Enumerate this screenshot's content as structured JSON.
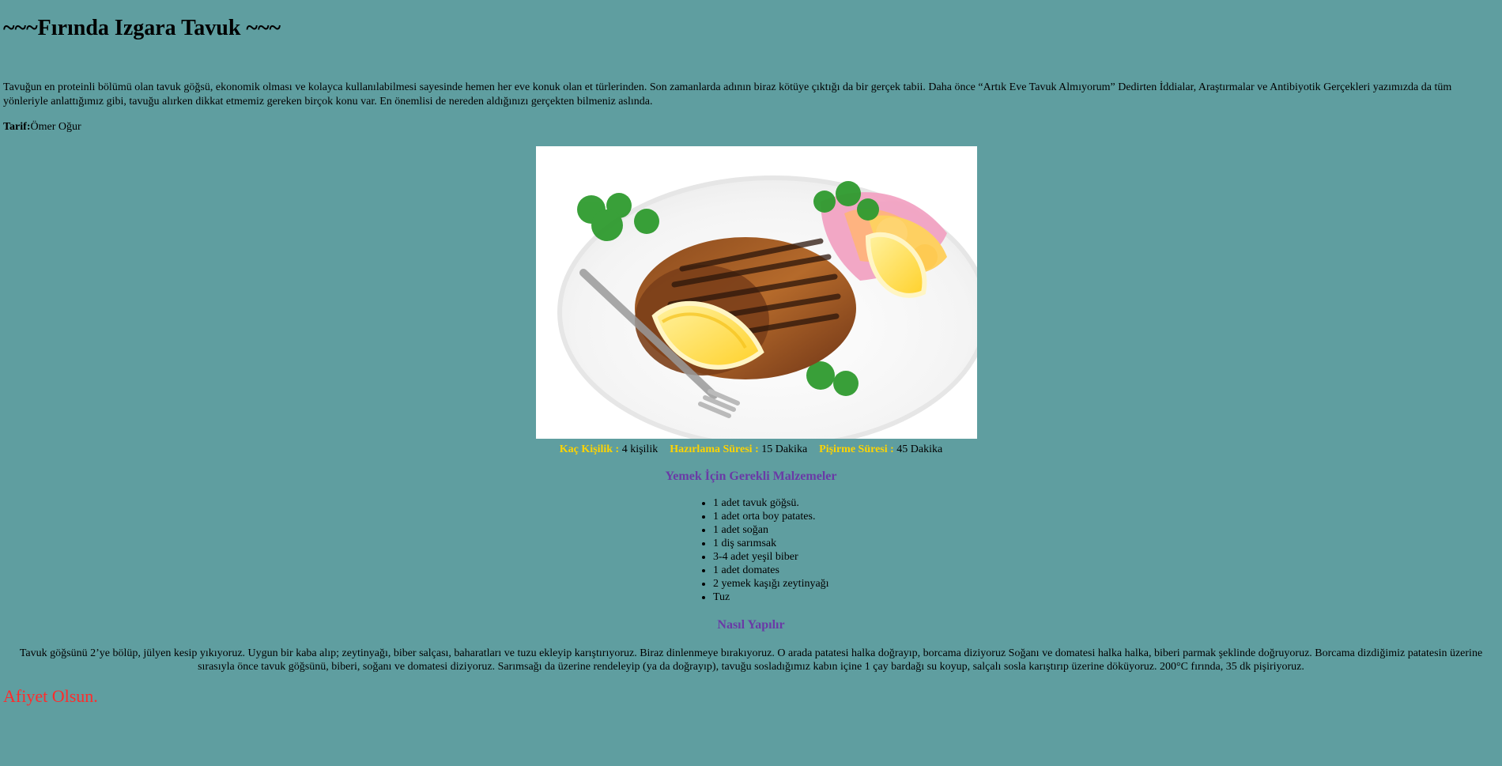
{
  "header": {
    "title": "~~~Fırında Izgara Tavuk ~~~"
  },
  "intro": {
    "text": "Tavuğun en proteinli bölümü olan tavuk göğsü, ekonomik olması ve kolayca kullanılabilmesi sayesinde hemen her eve konuk olan et türlerinden. Son zamanlarda adının biraz kötüye çıktığı da bir gerçek tabii. Daha önce “Artık Eve Tavuk Almıyorum” Dedirten İddialar, Araştırmalar ve Antibiyotik Gerçekleri yazımızda da tüm yönleriyle anlattığımız gibi, tavuğu alırken dikkat etmemiz gereken birçok konu var. En önemlisi de nereden aldığınızı gerçekten bilmeniz aslında."
  },
  "author": {
    "label": "Tarif:",
    "name": "Ömer Oğur"
  },
  "hero_image": {
    "icon": "grilled-chicken-plate"
  },
  "meta": {
    "servings_label": "Kaç Kişilik :",
    "servings_value": "4 kişilik",
    "prep_label": "Hazırlama Süresi :",
    "prep_value": "15 Dakika",
    "cook_label": "Pişirme Süresi :",
    "cook_value": "45 Dakika",
    "label_color": "#ffd400"
  },
  "ingredients": {
    "title": "Yemek İçin Gerekli Malzemeler",
    "items": [
      "1 adet tavuk göğsü.",
      "1 adet orta boy patates.",
      "1 adet soğan",
      "1 diş sarımsak",
      "3-4 adet yeşil biber",
      "1 adet domates",
      "2 yemek kaşığı zeytinyağı",
      "Tuz"
    ]
  },
  "howto": {
    "title": "Nasıl Yapılır",
    "text": "Tavuk göğsünü 2’ye bölüp, jülyen kesip yıkıyoruz. Uygun bir kaba alıp; zeytinyağı, biber salçası, baharatları ve tuzu ekleyip karıştırıyoruz. Biraz dinlenmeye bırakıyoruz. O arada patatesi halka doğrayıp, borcama diziyoruz Soğanı ve domatesi halka halka, biberi parmak şeklinde doğruyoruz. Borcama dizdiğimiz patatesin üzerine sırasıyla önce tavuk göğsünü, biberi, soğanı ve domatesi diziyoruz. Sarımsağı da üzerine rendeleyip (ya da doğrayıp), tavuğu sosladığımız kabın içine 1 çay bardağı su koyup, salçalı sosla karıştırıp üzerine döküyoruz. 200°C fırında, 35 dk pişiriyoruz."
  },
  "footer": {
    "text": "Afiyet Olsun."
  },
  "colors": {
    "background": "#5f9ea0",
    "section_title": "#6a3aa6",
    "footer": "#ff2b2b"
  }
}
